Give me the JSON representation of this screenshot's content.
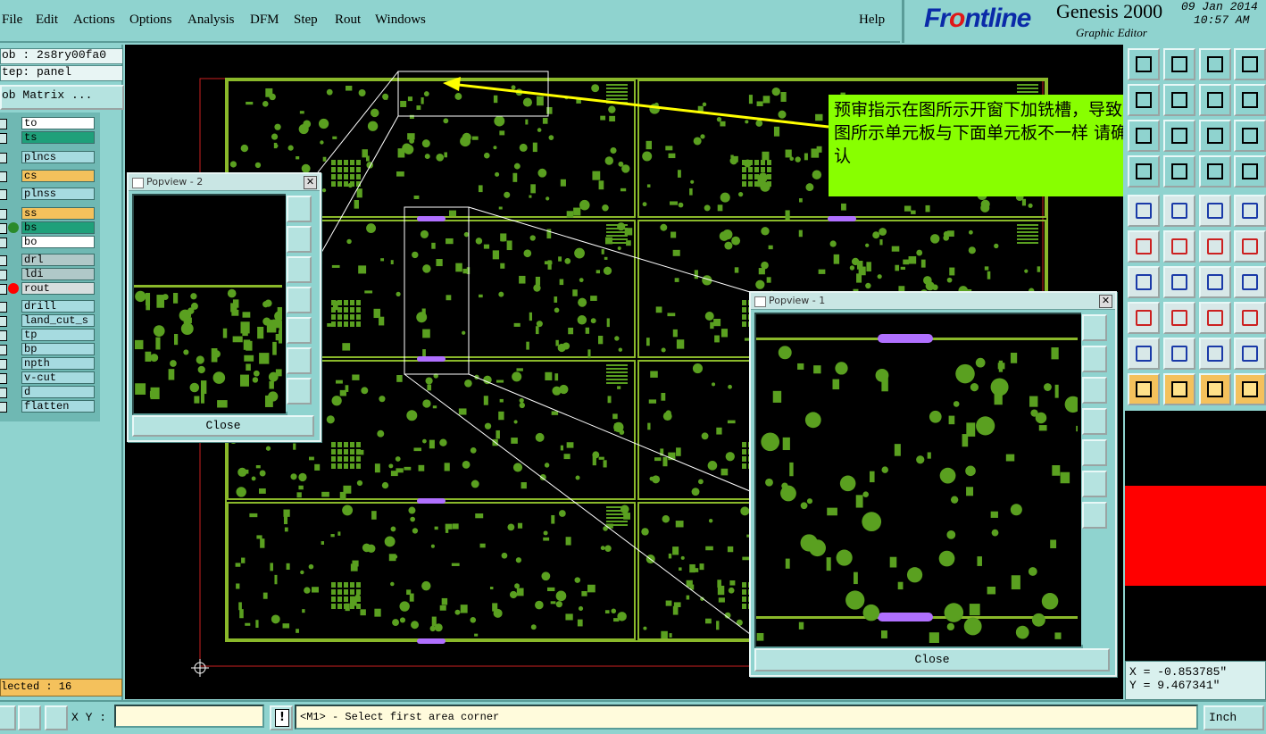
{
  "menu": {
    "file": "File",
    "edit": "Edit",
    "actions": "Actions",
    "options": "Options",
    "analysis": "Analysis",
    "dfm": "DFM",
    "step": "Step",
    "rout": "Rout",
    "windows": "Windows",
    "help": "Help"
  },
  "brand": {
    "logo_prefix": "Fr",
    "logo_o": "o",
    "logo_suffix": "ntline",
    "product": "Genesis 2000",
    "subtitle": "Graphic Editor",
    "date": "09 Jan 2014",
    "time": "10:57 AM"
  },
  "job": {
    "job_label": "ob : 2s8ry00fa0",
    "step_label": "tep: panel",
    "matrix_button": "ob Matrix ..."
  },
  "layers": [
    {
      "name": "to",
      "color": "#ffffff"
    },
    {
      "name": "ts",
      "color": "#1fa07a"
    },
    {
      "name": "plncs",
      "color": "#a6dbe0"
    },
    {
      "name": "cs",
      "color": "#f4c15c"
    },
    {
      "name": "plnss",
      "color": "#a6dbe0"
    },
    {
      "name": "ss",
      "color": "#f4c15c"
    },
    {
      "name": "bs",
      "color": "#1fa07a"
    },
    {
      "name": "bo",
      "color": "#ffffff"
    },
    {
      "name": "drl",
      "color": "#b0c8c8"
    },
    {
      "name": "ldi",
      "color": "#b0c8c8"
    },
    {
      "name": "rout",
      "color": "#d7dede"
    },
    {
      "name": "drill",
      "color": "#a6dbe0"
    },
    {
      "name": "land_cut_s",
      "color": "#a6dbe0"
    },
    {
      "name": "tp",
      "color": "#a6dbe0"
    },
    {
      "name": "bp",
      "color": "#a6dbe0"
    },
    {
      "name": "npth",
      "color": "#a6dbe0"
    },
    {
      "name": "v-cut",
      "color": "#a6dbe0"
    },
    {
      "name": "d",
      "color": "#a6dbe0"
    },
    {
      "name": "flatten",
      "color": "#a6dbe0"
    }
  ],
  "selected": "lected : 16",
  "annotation": "预审指示在图所示开窗下加铣槽，导致图所示单元板与下面单元板不一样  请确认",
  "popview2": {
    "title": "Popview - 2",
    "close": "Close"
  },
  "popview1": {
    "title": "Popview - 1",
    "close": "Close"
  },
  "coords": {
    "x": "X = -0.853785\"",
    "y": "Y = 9.467341\""
  },
  "status": {
    "xy_label": "X Y :",
    "prompt": "<M1> - Select first area corner",
    "units": "Inch"
  },
  "colors": {
    "board": "#5aa020",
    "panel": "#8ab82a",
    "slot": "#b070ff",
    "arrow": "#ffff00",
    "annotation_bg": "#88ff00"
  }
}
